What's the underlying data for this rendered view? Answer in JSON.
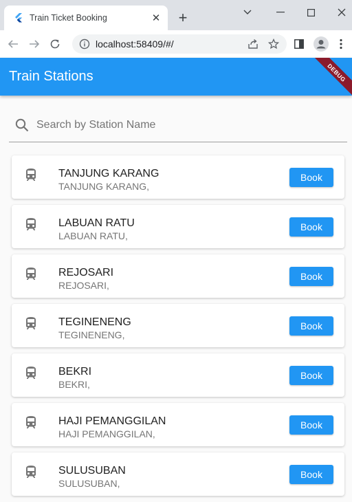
{
  "browser": {
    "tab_title": "Train Ticket Booking",
    "url": "localhost:58409/#/"
  },
  "app": {
    "title": "Train Stations",
    "debug_label": "DEBUG",
    "accent_color": "#2196f3"
  },
  "search": {
    "placeholder": "Search by Station Name"
  },
  "book_label": "Book",
  "stations": [
    {
      "name": "TANJUNG KARANG",
      "subtitle": "TANJUNG KARANG,"
    },
    {
      "name": "LABUAN RATU",
      "subtitle": "LABUAN RATU,"
    },
    {
      "name": "REJOSARI",
      "subtitle": "REJOSARI,"
    },
    {
      "name": "TEGINENENG",
      "subtitle": "TEGINENENG,"
    },
    {
      "name": "BEKRI",
      "subtitle": "BEKRI,"
    },
    {
      "name": "HAJI PEMANGGILAN",
      "subtitle": "HAJI PEMANGGILAN,"
    },
    {
      "name": "SULUSUBAN",
      "subtitle": "SULUSUBAN,"
    }
  ]
}
